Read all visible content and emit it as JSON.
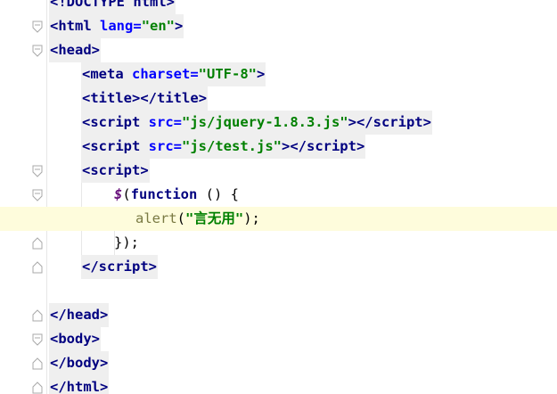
{
  "editor": {
    "lines": [
      {
        "tokens": [
          {
            "text": "<!DOCTYPE ",
            "type": "tag"
          },
          {
            "text": "html",
            "type": "tag"
          },
          {
            "text": ">",
            "type": "tag"
          }
        ]
      },
      {
        "tokens": [
          {
            "text": "<",
            "type": "tag"
          },
          {
            "text": "html ",
            "type": "tag"
          },
          {
            "text": "lang=",
            "type": "attr"
          },
          {
            "text": "\"en\"",
            "type": "str"
          },
          {
            "text": ">",
            "type": "tag"
          }
        ]
      },
      {
        "tokens": [
          {
            "text": "<",
            "type": "tag"
          },
          {
            "text": "head",
            "type": "tag"
          },
          {
            "text": ">",
            "type": "tag"
          }
        ]
      },
      {
        "tokens": [
          {
            "text": "<",
            "type": "tag"
          },
          {
            "text": "meta ",
            "type": "tag"
          },
          {
            "text": "charset=",
            "type": "attr"
          },
          {
            "text": "\"UTF-8\"",
            "type": "str"
          },
          {
            "text": ">",
            "type": "tag"
          }
        ]
      },
      {
        "tokens": [
          {
            "text": "<",
            "type": "tag"
          },
          {
            "text": "title",
            "type": "tag"
          },
          {
            "text": "></",
            "type": "tag"
          },
          {
            "text": "title",
            "type": "tag"
          },
          {
            "text": ">",
            "type": "tag"
          }
        ]
      },
      {
        "tokens": [
          {
            "text": "<",
            "type": "tag"
          },
          {
            "text": "script ",
            "type": "tag"
          },
          {
            "text": "src=",
            "type": "attr"
          },
          {
            "text": "\"js/jquery-1.8.3.js\"",
            "type": "str"
          },
          {
            "text": "></",
            "type": "tag"
          },
          {
            "text": "script",
            "type": "tag"
          },
          {
            "text": ">",
            "type": "tag"
          }
        ]
      },
      {
        "tokens": [
          {
            "text": "<",
            "type": "tag"
          },
          {
            "text": "script ",
            "type": "tag"
          },
          {
            "text": "src=",
            "type": "attr"
          },
          {
            "text": "\"js/test.js\"",
            "type": "str"
          },
          {
            "text": "></",
            "type": "tag"
          },
          {
            "text": "script",
            "type": "tag"
          },
          {
            "text": ">",
            "type": "tag"
          }
        ]
      },
      {
        "tokens": [
          {
            "text": "<",
            "type": "tag"
          },
          {
            "text": "script",
            "type": "tag"
          },
          {
            "text": ">",
            "type": "tag"
          }
        ]
      },
      {
        "tokens": [
          {
            "text": "$",
            "type": "js-dollar"
          },
          {
            "text": "(",
            "type": "punct"
          },
          {
            "text": "function",
            "type": "js-kw"
          },
          {
            "text": " () {",
            "type": "punct"
          }
        ]
      },
      {
        "tokens": [
          {
            "text": "alert",
            "type": "js-fn"
          },
          {
            "text": "(",
            "type": "punct"
          },
          {
            "text": "\"言无用\"",
            "type": "str"
          },
          {
            "text": ");",
            "type": "punct"
          }
        ]
      },
      {
        "tokens": [
          {
            "text": "});",
            "type": "punct"
          }
        ]
      },
      {
        "tokens": [
          {
            "text": "</",
            "type": "tag"
          },
          {
            "text": "script",
            "type": "tag"
          },
          {
            "text": ">",
            "type": "tag"
          }
        ]
      },
      {
        "tokens": []
      },
      {
        "tokens": [
          {
            "text": "</",
            "type": "tag"
          },
          {
            "text": "head",
            "type": "tag"
          },
          {
            "text": ">",
            "type": "tag"
          }
        ]
      },
      {
        "tokens": [
          {
            "text": "<",
            "type": "tag"
          },
          {
            "text": "body",
            "type": "tag"
          },
          {
            "text": ">",
            "type": "tag"
          }
        ]
      },
      {
        "tokens": [
          {
            "text": "</",
            "type": "tag"
          },
          {
            "text": "body",
            "type": "tag"
          },
          {
            "text": ">",
            "type": "tag"
          }
        ]
      },
      {
        "tokens": [
          {
            "text": "</",
            "type": "tag"
          },
          {
            "text": "html",
            "type": "tag"
          },
          {
            "text": ">",
            "type": "tag"
          }
        ]
      }
    ]
  },
  "colors": {
    "tag": "#000080",
    "attribute": "#0000ff",
    "string": "#008000",
    "current_line": "#fefcdc",
    "tag_highlight": "#efefef"
  },
  "icons": {
    "fold_open": "fold-open-icon",
    "fold_close": "fold-end-icon"
  }
}
